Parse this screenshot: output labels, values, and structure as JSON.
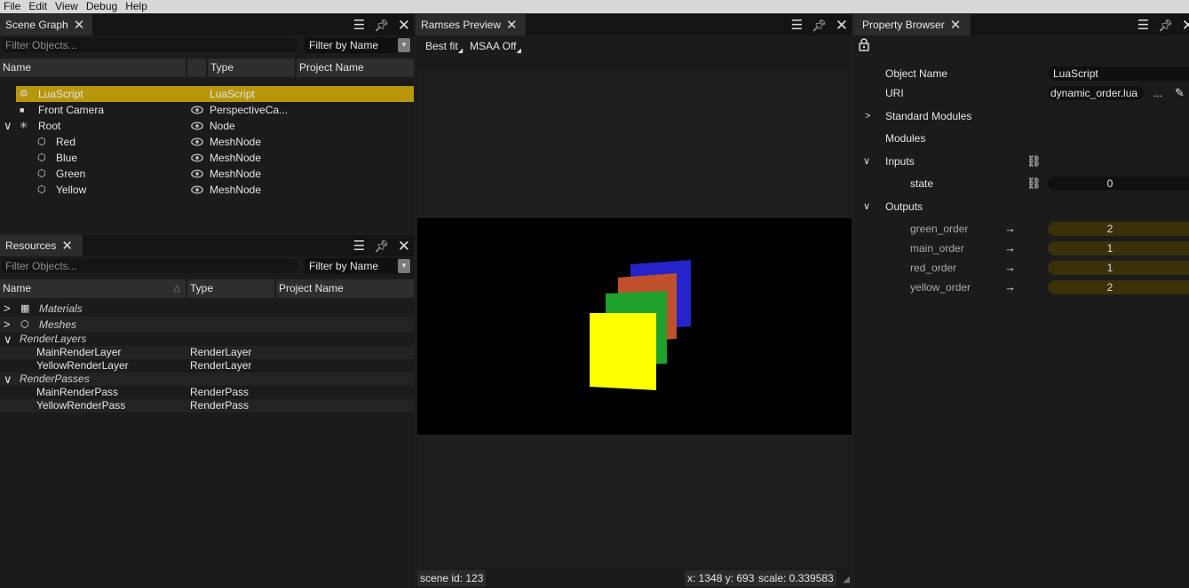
{
  "menubar": [
    "File",
    "Edit",
    "View",
    "Debug",
    "Help"
  ],
  "scene_graph": {
    "title": "Scene Graph",
    "filter_placeholder": "Filter Objects...",
    "filter_mode": "Filter by Name",
    "columns": [
      "Name",
      "",
      "Type",
      "Project Name"
    ],
    "rows": [
      {
        "name": "LuaScript",
        "type": "LuaScript",
        "icon": "lua-script-icon",
        "visible": false,
        "selected": true,
        "level": 1
      },
      {
        "name": "Front Camera",
        "type": "PerspectiveCa...",
        "icon": "camera-icon",
        "visible": true,
        "selected": false,
        "level": 1
      },
      {
        "name": "Root",
        "type": "Node",
        "icon": "node-icon",
        "visible": true,
        "selected": false,
        "level": 1,
        "expanded": true
      },
      {
        "name": "Red",
        "type": "MeshNode",
        "icon": "mesh-icon",
        "visible": true,
        "selected": false,
        "level": 2
      },
      {
        "name": "Blue",
        "type": "MeshNode",
        "icon": "mesh-icon",
        "visible": true,
        "selected": false,
        "level": 2
      },
      {
        "name": "Green",
        "type": "MeshNode",
        "icon": "mesh-icon",
        "visible": true,
        "selected": false,
        "level": 2
      },
      {
        "name": "Yellow",
        "type": "MeshNode",
        "icon": "mesh-icon",
        "visible": true,
        "selected": false,
        "level": 2
      }
    ]
  },
  "resources": {
    "title": "Resources",
    "filter_placeholder": "Filter Objects...",
    "filter_mode": "Filter by Name",
    "columns": [
      "Name",
      "Type",
      "Project Name"
    ],
    "rows": [
      {
        "name": "Materials",
        "type": "",
        "group": true,
        "expanded": false,
        "icon": "material-icon"
      },
      {
        "name": "Meshes",
        "type": "",
        "group": true,
        "expanded": false,
        "icon": "mesh-icon"
      },
      {
        "name": "RenderLayers",
        "type": "",
        "group": true,
        "expanded": true
      },
      {
        "name": "MainRenderLayer",
        "type": "RenderLayer",
        "group": false
      },
      {
        "name": "YellowRenderLayer",
        "type": "RenderLayer",
        "group": false
      },
      {
        "name": "RenderPasses",
        "type": "",
        "group": true,
        "expanded": true
      },
      {
        "name": "MainRenderPass",
        "type": "RenderPass",
        "group": false
      },
      {
        "name": "YellowRenderPass",
        "type": "RenderPass",
        "group": false
      }
    ]
  },
  "preview": {
    "title": "Ramses Preview",
    "size_mode": "Best fit",
    "msaa": "MSAA Off",
    "scene_id": "scene id: 123",
    "coords": "x: 1348 y: 693",
    "scale": "scale: 0.339583",
    "colors": {
      "blue": "#2424c8",
      "red": "#c0502c",
      "green": "#20a02c",
      "yellow": "#ffff00"
    }
  },
  "property_browser": {
    "title": "Property Browser",
    "object_name_label": "Object Name",
    "object_name": "LuaScript",
    "uri_label": "URI",
    "uri": "dynamic_order.lua",
    "uri_more": "...",
    "standard_modules": "Standard Modules",
    "modules": "Modules",
    "inputs_label": "Inputs",
    "inputs": [
      {
        "name": "state",
        "value": "0"
      }
    ],
    "outputs_label": "Outputs",
    "outputs": [
      {
        "name": "green_order",
        "value": "2"
      },
      {
        "name": "main_order",
        "value": "1"
      },
      {
        "name": "red_order",
        "value": "1"
      },
      {
        "name": "yellow_order",
        "value": "2"
      }
    ]
  }
}
